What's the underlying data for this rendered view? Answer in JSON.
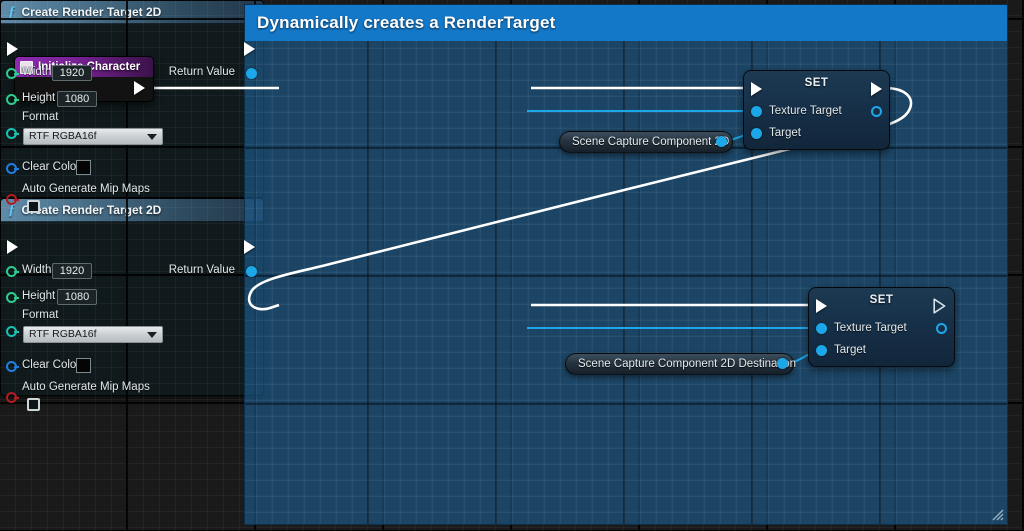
{
  "comment": {
    "title": "Dynamically creates a RenderTarget",
    "color": "#1478c8",
    "fill": "#1e6195"
  },
  "nodes": {
    "event": {
      "title": "Initialize Character",
      "icon": "event-node-icon",
      "exec_out": "exec-out"
    },
    "create_rt_1": {
      "title": "Create Render Target 2D",
      "icon": "function-icon",
      "inputs": [
        {
          "label": "Width",
          "value": "1920",
          "pin": "int"
        },
        {
          "label": "Height",
          "value": "1080",
          "pin": "int"
        },
        {
          "label": "Format",
          "value": "RTF RGBA16f",
          "pin": "enum"
        },
        {
          "label": "Clear Color",
          "value": "#000000",
          "pin": "struct"
        },
        {
          "label": "Auto Generate Mip Maps",
          "value": "unchecked",
          "pin": "bool"
        }
      ],
      "outputs": [
        {
          "label": "Return Value",
          "pin": "object"
        }
      ]
    },
    "create_rt_2": {
      "title": "Create Render Target 2D",
      "icon": "function-icon",
      "inputs": [
        {
          "label": "Width",
          "value": "1920",
          "pin": "int"
        },
        {
          "label": "Height",
          "value": "1080",
          "pin": "int"
        },
        {
          "label": "Format",
          "value": "RTF RGBA16f",
          "pin": "enum"
        },
        {
          "label": "Clear Color",
          "value": "#000000",
          "pin": "struct"
        },
        {
          "label": "Auto Generate Mip Maps",
          "value": "unchecked",
          "pin": "bool"
        }
      ],
      "outputs": [
        {
          "label": "Return Value",
          "pin": "object"
        }
      ]
    },
    "set_1": {
      "title": "SET",
      "inputs": [
        {
          "label": "Texture Target"
        },
        {
          "label": "Target"
        }
      ]
    },
    "set_2": {
      "title": "SET",
      "inputs": [
        {
          "label": "Texture Target"
        },
        {
          "label": "Target"
        }
      ]
    },
    "var_1": {
      "title": "Scene Capture Component 2D"
    },
    "var_2": {
      "title": "Scene Capture Component 2D Destination"
    }
  }
}
